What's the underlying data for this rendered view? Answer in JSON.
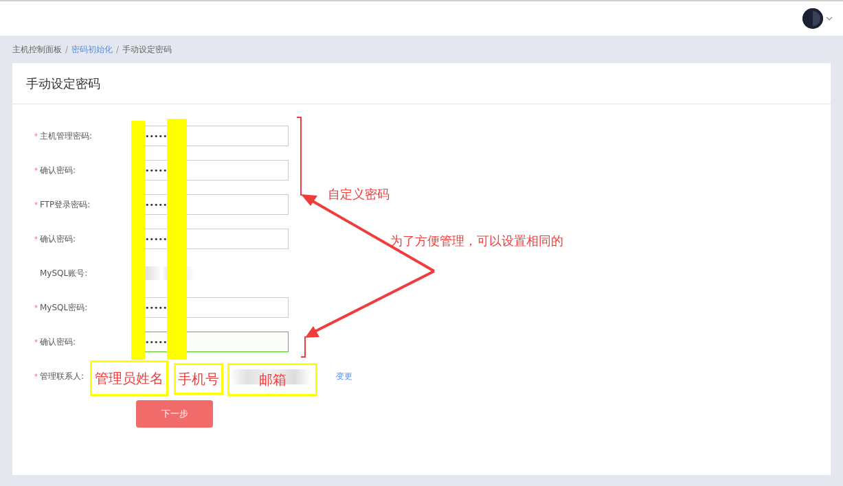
{
  "breadcrumb": [
    {
      "label": "主机控制面板",
      "kind": "text"
    },
    {
      "label": "/",
      "kind": "separator"
    },
    {
      "label": "密码初始化",
      "kind": "link"
    },
    {
      "label": "/",
      "kind": "separator"
    },
    {
      "label": "手动设定密码",
      "kind": "text"
    }
  ],
  "title": "手动设定密码",
  "form": {
    "fields": [
      {
        "label": "主机管理密码:",
        "required_mark": "*",
        "kind": "password",
        "value": "•••••",
        "focused": false
      },
      {
        "label": "确认密码:",
        "required_mark": "*",
        "kind": "password",
        "value": "•••••",
        "focused": false
      },
      {
        "label": "FTP登录密码:",
        "required_mark": "*",
        "kind": "password",
        "value": "•••••",
        "focused": false
      },
      {
        "label": "确认密码:",
        "required_mark": "*",
        "kind": "password",
        "value": "•••••",
        "focused": false
      },
      {
        "label": "MySQL账号:",
        "kind": "text"
      },
      {
        "label": "MySQL密码:",
        "required_mark": "*",
        "kind": "password",
        "value": "•••••",
        "focused": false
      },
      {
        "label": "确认密码:",
        "required_mark": "*",
        "kind": "password",
        "value": "•••••",
        "focused": true
      }
    ],
    "contact": {
      "label": "管理联系人:",
      "required_mark": "*",
      "change_link": "变更"
    },
    "submit": "下一步"
  },
  "annotations": {
    "callouts": [
      "自定义密码",
      "为了方便管理，可以设置相同的"
    ],
    "boxes": [
      "管理员姓名",
      "手机号",
      "邮箱"
    ]
  }
}
